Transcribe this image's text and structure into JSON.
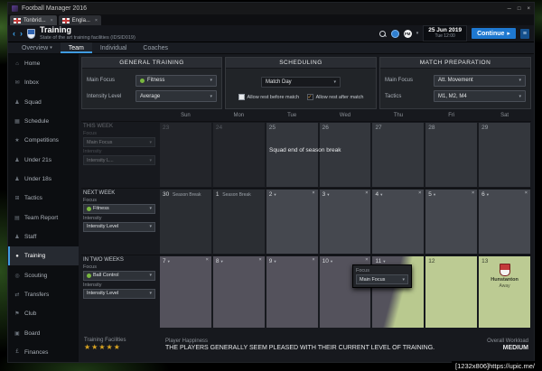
{
  "glyphs": {
    "chevron_down": "▾",
    "close": "×",
    "check": "✓",
    "stars": "★★★★★",
    "menu": "≡",
    "play": "▸",
    "back": "‹",
    "forward": "›",
    "minimize": "─",
    "maximize": "□"
  },
  "window_chrome": {
    "title": "Football Manager 2016"
  },
  "tabs": [
    {
      "label": "Tonbrid..."
    },
    {
      "label": "Engla..."
    }
  ],
  "header": {
    "title": "Training",
    "subtitle": "State of the art training facilities (IDSID019)",
    "fm": "FM",
    "date": "25 Jun 2019",
    "time": "Tue 12:00",
    "continue_label": "Continue"
  },
  "subtabs": [
    "Overview",
    "Team",
    "Individual",
    "Coaches"
  ],
  "sidebar": {
    "items": [
      "Home",
      "Inbox",
      "Squad",
      "Schedule",
      "Competitions",
      "Under 21s",
      "Under 18s",
      "Tactics",
      "Team Report",
      "Staff",
      "Training",
      "Scouting",
      "Transfers",
      "Club",
      "Board",
      "Finances"
    ],
    "icons": [
      "⌂",
      "✉",
      "♟",
      "▦",
      "★",
      "♟",
      "♟",
      "⊞",
      "▤",
      "♟",
      "●",
      "◎",
      "⇄",
      "⚑",
      "▣",
      "£"
    ]
  },
  "general_training": {
    "title": "GENERAL TRAINING",
    "main_focus_label": "Main Focus",
    "main_focus": "Fitness",
    "intensity_label": "Intensity Level",
    "intensity": "Average"
  },
  "scheduling": {
    "title": "SCHEDULING",
    "dropdown": "Match Day",
    "before_label": "Allow rest before match",
    "after_label": "Allow rest after match"
  },
  "match_preparation": {
    "title": "MATCH PREPARATION",
    "main_focus_label": "Main Focus",
    "main_focus": "Att. Movement",
    "tactics_label": "Tactics",
    "tactics": "M1, M2, M4"
  },
  "calendar": {
    "day_headers": [
      "Sun",
      "Mon",
      "Tue",
      "Wed",
      "Thu",
      "Fri",
      "Sat"
    ],
    "note": "Squad end of season break",
    "this_week": {
      "label": "THIS WEEK",
      "focus_label": "Focus",
      "focus": "Main Focus",
      "intensity_label": "Intensity",
      "intensity": "Intensity L..."
    },
    "next_week": {
      "label": "NEXT WEEK",
      "focus_label": "Focus",
      "focus": "Fitness",
      "intensity_label": "Intensity",
      "intensity": "Intensity Level"
    },
    "two_weeks": {
      "label": "IN TWO WEEKS",
      "focus_label": "Focus",
      "focus": "Ball Control",
      "intensity_label": "Intensity",
      "intensity": "Intensity Level"
    },
    "week1": [
      "23",
      "24",
      "25",
      "26",
      "27",
      "28",
      "29"
    ],
    "week2": {
      "d0": "30",
      "d0_sub": "Season Break",
      "d1": "1",
      "d1_sub": "Season Break",
      "d2": "2",
      "d3": "3",
      "d4": "4",
      "d5": "5",
      "d6": "6"
    },
    "week3": {
      "d0": "7",
      "d1": "8",
      "d2": "9",
      "d3": "10",
      "d4": "11",
      "d5": "12",
      "d6": "13"
    },
    "popup": {
      "label": "Focus",
      "value": "Main Focus"
    },
    "match": {
      "name": "Hunstanton",
      "venue": "Away"
    }
  },
  "footer": {
    "facilities_label": "Training Facilities",
    "happiness_label": "Player Happiness",
    "happiness": "THE PLAYERS GENERALLY SEEM PLEASED WITH THEIR CURRENT LEVEL OF TRAINING.",
    "workload_label": "Overall Workload",
    "workload": "MEDIUM"
  },
  "watermark": "[1232x806]https://upic.me/"
}
